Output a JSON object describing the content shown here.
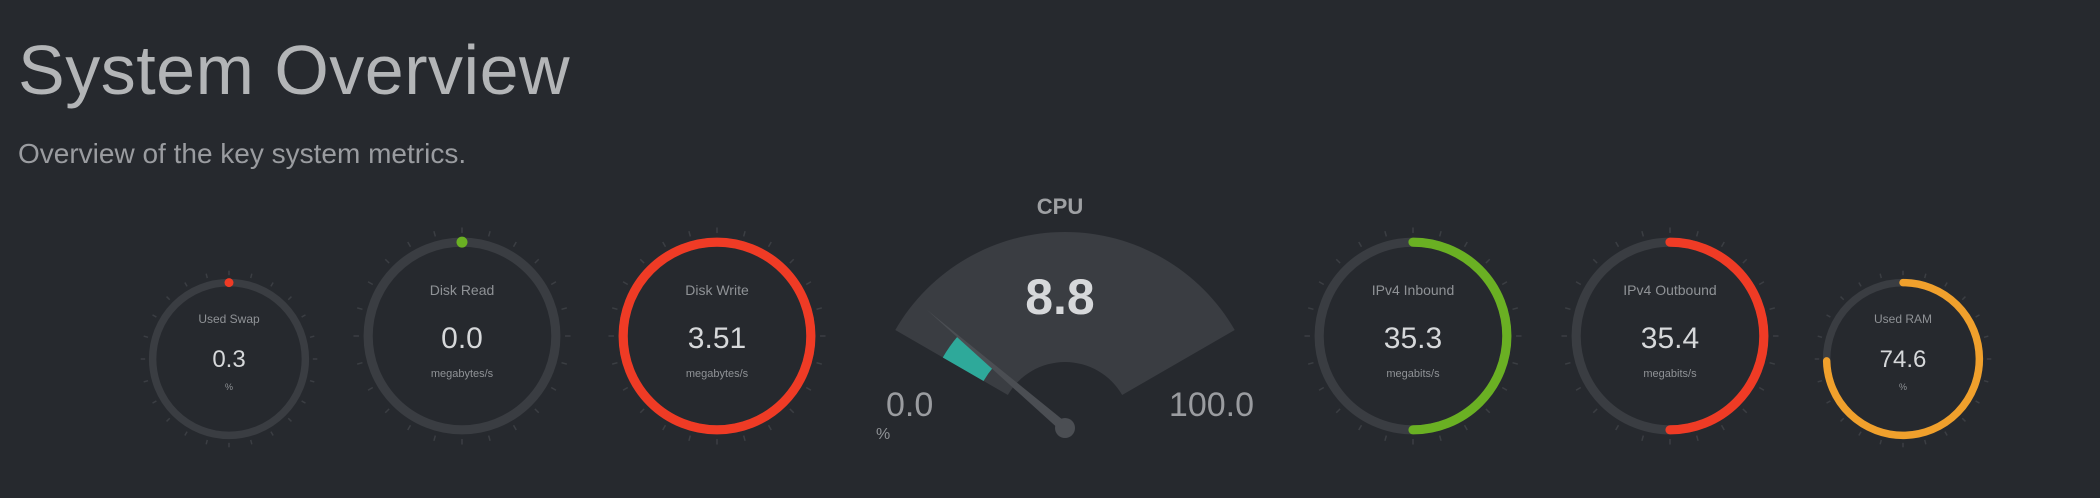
{
  "header": {
    "title": "System Overview",
    "subtitle": "Overview of the key system metrics."
  },
  "gauges": [
    {
      "key": "swap",
      "label": "Used Swap",
      "value": "0.3",
      "unit": "%",
      "fraction": 0.003,
      "color": "#ef3b25"
    },
    {
      "key": "disk_read",
      "label": "Disk Read",
      "value": "0.0",
      "unit": "megabytes/s",
      "fraction": 0.0,
      "color": "#6ab023"
    },
    {
      "key": "disk_write",
      "label": "Disk Write",
      "value": "3.51",
      "unit": "megabytes/s",
      "fraction": 1.0,
      "color": "#ef3b25"
    },
    {
      "key": "ipv4_in",
      "label": "IPv4 Inbound",
      "value": "35.3",
      "unit": "megabits/s",
      "fraction": 0.5,
      "color": "#6ab023"
    },
    {
      "key": "ipv4_out",
      "label": "IPv4 Outbound",
      "value": "35.4",
      "unit": "megabits/s",
      "fraction": 0.5,
      "color": "#ef3b25"
    },
    {
      "key": "ram",
      "label": "Used RAM",
      "value": "74.6",
      "unit": "%",
      "fraction": 0.746,
      "color": "#f0a02c"
    }
  ],
  "cpu": {
    "label": "CPU",
    "value": "8.8",
    "value_num": 8.8,
    "min": "0.0",
    "max": "100.0",
    "unit": "%",
    "band_color": "#2ea99a"
  }
}
